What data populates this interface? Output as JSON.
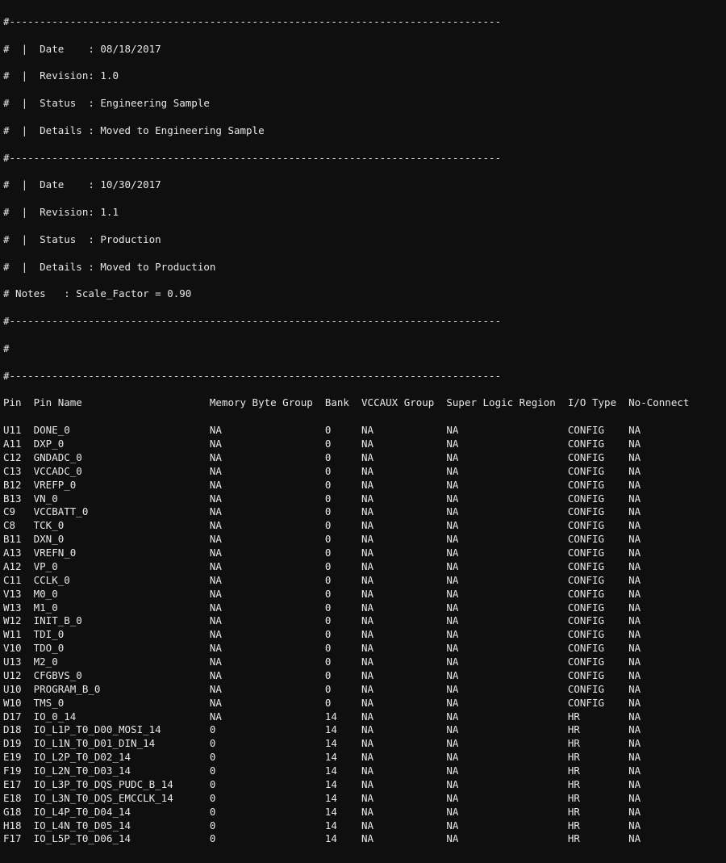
{
  "header": {
    "dash_line": "#---------------------------------------------------------------------------------",
    "rev0": {
      "date": "#  |  Date    : 08/18/2017",
      "rev": "#  |  Revision: 1.0",
      "status": "#  |  Status  : Engineering Sample",
      "details": "#  |  Details : Moved to Engineering Sample"
    },
    "rev1": {
      "date": "#  |  Date    : 10/30/2017",
      "rev": "#  |  Revision: 1.1",
      "status": "#  |  Status  : Production",
      "details": "#  |  Details : Moved to Production"
    },
    "notes": "# Notes   : Scale_Factor = 0.90",
    "blank": "#"
  },
  "columns": [
    {
      "key": "pin",
      "label": "Pin",
      "width": 5
    },
    {
      "key": "name",
      "label": "Pin Name",
      "width": 29
    },
    {
      "key": "mbg",
      "label": "Memory Byte Group",
      "width": 19
    },
    {
      "key": "bank",
      "label": "Bank",
      "width": 6
    },
    {
      "key": "vccaux",
      "label": "VCCAUX Group",
      "width": 14
    },
    {
      "key": "slr",
      "label": "Super Logic Region",
      "width": 20
    },
    {
      "key": "io",
      "label": "I/O Type",
      "width": 10
    },
    {
      "key": "nc",
      "label": "No-Connect",
      "width": 10
    }
  ],
  "rows": [
    {
      "pin": "U11",
      "name": "DONE_0",
      "mbg": "NA",
      "bank": "0",
      "vccaux": "NA",
      "slr": "NA",
      "io": "CONFIG",
      "nc": "NA"
    },
    {
      "pin": "A11",
      "name": "DXP_0",
      "mbg": "NA",
      "bank": "0",
      "vccaux": "NA",
      "slr": "NA",
      "io": "CONFIG",
      "nc": "NA"
    },
    {
      "pin": "C12",
      "name": "GNDADC_0",
      "mbg": "NA",
      "bank": "0",
      "vccaux": "NA",
      "slr": "NA",
      "io": "CONFIG",
      "nc": "NA"
    },
    {
      "pin": "C13",
      "name": "VCCADC_0",
      "mbg": "NA",
      "bank": "0",
      "vccaux": "NA",
      "slr": "NA",
      "io": "CONFIG",
      "nc": "NA"
    },
    {
      "pin": "B12",
      "name": "VREFP_0",
      "mbg": "NA",
      "bank": "0",
      "vccaux": "NA",
      "slr": "NA",
      "io": "CONFIG",
      "nc": "NA"
    },
    {
      "pin": "B13",
      "name": "VN_0",
      "mbg": "NA",
      "bank": "0",
      "vccaux": "NA",
      "slr": "NA",
      "io": "CONFIG",
      "nc": "NA"
    },
    {
      "pin": "C9",
      "name": "VCCBATT_0",
      "mbg": "NA",
      "bank": "0",
      "vccaux": "NA",
      "slr": "NA",
      "io": "CONFIG",
      "nc": "NA"
    },
    {
      "pin": "C8",
      "name": "TCK_0",
      "mbg": "NA",
      "bank": "0",
      "vccaux": "NA",
      "slr": "NA",
      "io": "CONFIG",
      "nc": "NA"
    },
    {
      "pin": "B11",
      "name": "DXN_0",
      "mbg": "NA",
      "bank": "0",
      "vccaux": "NA",
      "slr": "NA",
      "io": "CONFIG",
      "nc": "NA"
    },
    {
      "pin": "A13",
      "name": "VREFN_0",
      "mbg": "NA",
      "bank": "0",
      "vccaux": "NA",
      "slr": "NA",
      "io": "CONFIG",
      "nc": "NA"
    },
    {
      "pin": "A12",
      "name": "VP_0",
      "mbg": "NA",
      "bank": "0",
      "vccaux": "NA",
      "slr": "NA",
      "io": "CONFIG",
      "nc": "NA"
    },
    {
      "pin": "C11",
      "name": "CCLK_0",
      "mbg": "NA",
      "bank": "0",
      "vccaux": "NA",
      "slr": "NA",
      "io": "CONFIG",
      "nc": "NA"
    },
    {
      "pin": "V13",
      "name": "M0_0",
      "mbg": "NA",
      "bank": "0",
      "vccaux": "NA",
      "slr": "NA",
      "io": "CONFIG",
      "nc": "NA"
    },
    {
      "pin": "W13",
      "name": "M1_0",
      "mbg": "NA",
      "bank": "0",
      "vccaux": "NA",
      "slr": "NA",
      "io": "CONFIG",
      "nc": "NA"
    },
    {
      "pin": "W12",
      "name": "INIT_B_0",
      "mbg": "NA",
      "bank": "0",
      "vccaux": "NA",
      "slr": "NA",
      "io": "CONFIG",
      "nc": "NA"
    },
    {
      "pin": "W11",
      "name": "TDI_0",
      "mbg": "NA",
      "bank": "0",
      "vccaux": "NA",
      "slr": "NA",
      "io": "CONFIG",
      "nc": "NA"
    },
    {
      "pin": "V10",
      "name": "TDO_0",
      "mbg": "NA",
      "bank": "0",
      "vccaux": "NA",
      "slr": "NA",
      "io": "CONFIG",
      "nc": "NA"
    },
    {
      "pin": "U13",
      "name": "M2_0",
      "mbg": "NA",
      "bank": "0",
      "vccaux": "NA",
      "slr": "NA",
      "io": "CONFIG",
      "nc": "NA"
    },
    {
      "pin": "U12",
      "name": "CFGBVS_0",
      "mbg": "NA",
      "bank": "0",
      "vccaux": "NA",
      "slr": "NA",
      "io": "CONFIG",
      "nc": "NA"
    },
    {
      "pin": "U10",
      "name": "PROGRAM_B_0",
      "mbg": "NA",
      "bank": "0",
      "vccaux": "NA",
      "slr": "NA",
      "io": "CONFIG",
      "nc": "NA"
    },
    {
      "pin": "W10",
      "name": "TMS_0",
      "mbg": "NA",
      "bank": "0",
      "vccaux": "NA",
      "slr": "NA",
      "io": "CONFIG",
      "nc": "NA"
    },
    {
      "pin": "D17",
      "name": "IO_0_14",
      "mbg": "NA",
      "bank": "14",
      "vccaux": "NA",
      "slr": "NA",
      "io": "HR",
      "nc": "NA"
    },
    {
      "pin": "D18",
      "name": "IO_L1P_T0_D00_MOSI_14",
      "mbg": "0",
      "bank": "14",
      "vccaux": "NA",
      "slr": "NA",
      "io": "HR",
      "nc": "NA"
    },
    {
      "pin": "D19",
      "name": "IO_L1N_T0_D01_DIN_14",
      "mbg": "0",
      "bank": "14",
      "vccaux": "NA",
      "slr": "NA",
      "io": "HR",
      "nc": "NA"
    },
    {
      "pin": "E19",
      "name": "IO_L2P_T0_D02_14",
      "mbg": "0",
      "bank": "14",
      "vccaux": "NA",
      "slr": "NA",
      "io": "HR",
      "nc": "NA"
    },
    {
      "pin": "F19",
      "name": "IO_L2N_T0_D03_14",
      "mbg": "0",
      "bank": "14",
      "vccaux": "NA",
      "slr": "NA",
      "io": "HR",
      "nc": "NA"
    },
    {
      "pin": "E17",
      "name": "IO_L3P_T0_DQS_PUDC_B_14",
      "mbg": "0",
      "bank": "14",
      "vccaux": "NA",
      "slr": "NA",
      "io": "HR",
      "nc": "NA"
    },
    {
      "pin": "E18",
      "name": "IO_L3N_T0_DQS_EMCCLK_14",
      "mbg": "0",
      "bank": "14",
      "vccaux": "NA",
      "slr": "NA",
      "io": "HR",
      "nc": "NA"
    },
    {
      "pin": "G18",
      "name": "IO_L4P_T0_D04_14",
      "mbg": "0",
      "bank": "14",
      "vccaux": "NA",
      "slr": "NA",
      "io": "HR",
      "nc": "NA"
    },
    {
      "pin": "H18",
      "name": "IO_L4N_T0_D05_14",
      "mbg": "0",
      "bank": "14",
      "vccaux": "NA",
      "slr": "NA",
      "io": "HR",
      "nc": "NA"
    },
    {
      "pin": "F17",
      "name": "IO_L5P_T0_D06_14",
      "mbg": "0",
      "bank": "14",
      "vccaux": "NA",
      "slr": "NA",
      "io": "HR",
      "nc": "NA"
    }
  ]
}
